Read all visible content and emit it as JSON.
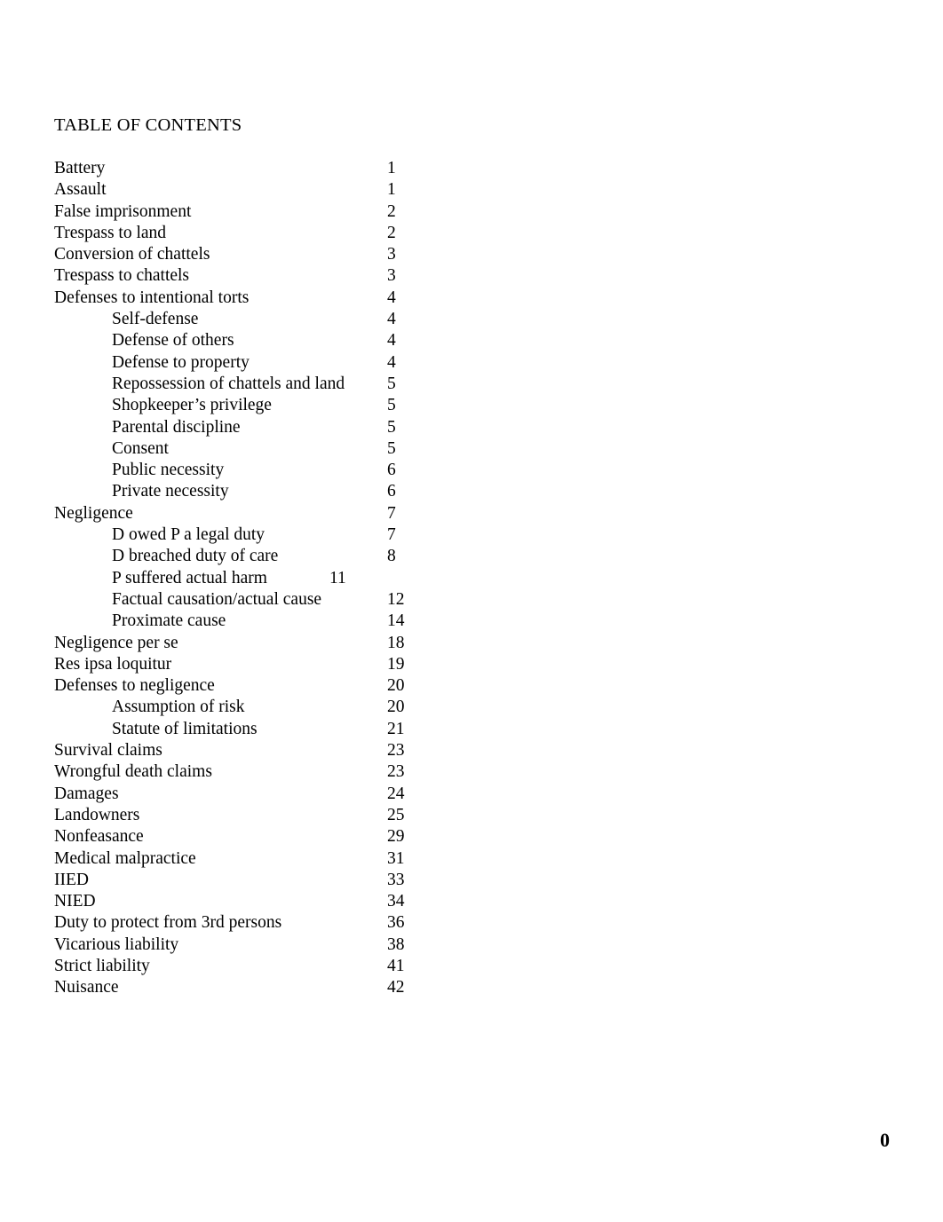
{
  "document": {
    "heading": "TABLE OF CONTENTS",
    "footer_page_number": "0"
  },
  "toc": {
    "entries": [
      {
        "label": "Battery",
        "page": "1",
        "level": 0,
        "num_style": "col-a"
      },
      {
        "label": "Assault",
        "page": "1",
        "level": 0,
        "num_style": "col-a"
      },
      {
        "label": "False imprisonment",
        "page": "2",
        "level": 0,
        "num_style": "col-a"
      },
      {
        "label": "Trespass to land",
        "page": "2",
        "level": 0,
        "num_style": "col-a"
      },
      {
        "label": "Conversion of chattels",
        "page": "3",
        "level": 0,
        "num_style": "col-a"
      },
      {
        "label": "Trespass to chattels",
        "page": "3",
        "level": 0,
        "num_style": "col-a"
      },
      {
        "label": "Defenses to intentional torts",
        "page": "4",
        "level": 0,
        "num_style": "col-a"
      },
      {
        "label": "Self-defense",
        "page": "4",
        "level": 1,
        "num_style": "col-a"
      },
      {
        "label": "Defense of others",
        "page": "4",
        "level": 1,
        "num_style": "col-a"
      },
      {
        "label": "Defense to property",
        "page": "4",
        "level": 1,
        "num_style": "col-a"
      },
      {
        "label": "Repossession of chattels and land",
        "page": "5",
        "level": 1,
        "num_style": "col-a"
      },
      {
        "label": "Shopkeeper’s privilege",
        "page": "5",
        "level": 1,
        "num_style": "col-a"
      },
      {
        "label": "Parental discipline",
        "page": "5",
        "level": 1,
        "num_style": "col-a"
      },
      {
        "label": "Consent",
        "page": "5",
        "level": 1,
        "num_style": "col-a"
      },
      {
        "label": "Public necessity",
        "page": "6",
        "level": 1,
        "num_style": "col-a"
      },
      {
        "label": "Private necessity",
        "page": "6",
        "level": 1,
        "num_style": "col-a"
      },
      {
        "label": "Negligence",
        "page": "7",
        "level": 0,
        "num_style": "col-a"
      },
      {
        "label": "D owed P a legal duty",
        "page": "7",
        "level": 1,
        "num_style": "col-a"
      },
      {
        "label": "D breached duty of care",
        "page": "8",
        "level": 1,
        "num_style": "col-a"
      },
      {
        "label": "P suffered actual harm",
        "page": "11",
        "level": 1,
        "num_style": "inline"
      },
      {
        "label": "Factual causation/actual cause",
        "page": "12",
        "level": 1,
        "num_style": "col-b"
      },
      {
        "label": "Proximate cause",
        "page": "14",
        "level": 1,
        "num_style": "col-b"
      },
      {
        "label": "Negligence per se",
        "page": "18",
        "level": 0,
        "num_style": "col-b"
      },
      {
        "label": "Res ipsa loquitur",
        "page": "19",
        "level": 0,
        "num_style": "col-b"
      },
      {
        "label": "Defenses to negligence",
        "page": "20",
        "level": 0,
        "num_style": "col-b"
      },
      {
        "label": "Assumption of risk",
        "page": "20",
        "level": 1,
        "num_style": "col-b"
      },
      {
        "label": "Statute of limitations",
        "page": "21",
        "level": 1,
        "num_style": "col-b"
      },
      {
        "label": "Survival claims",
        "page": "23",
        "level": 0,
        "num_style": "col-b"
      },
      {
        "label": "Wrongful death claims",
        "page": "23",
        "level": 0,
        "num_style": "col-b"
      },
      {
        "label": "Damages",
        "page": "24",
        "level": 0,
        "num_style": "col-b"
      },
      {
        "label": "Landowners",
        "page": "25",
        "level": 0,
        "num_style": "col-b"
      },
      {
        "label": "Nonfeasance",
        "page": "29",
        "level": 0,
        "num_style": "col-b"
      },
      {
        "label": "Medical malpractice",
        "page": "31",
        "level": 0,
        "num_style": "col-b"
      },
      {
        "label": "IIED",
        "page": "33",
        "level": 0,
        "num_style": "col-b"
      },
      {
        "label": "NIED",
        "page": "34",
        "level": 0,
        "num_style": "col-b"
      },
      {
        "label": "Duty to protect from 3rd persons",
        "page": "36",
        "level": 0,
        "num_style": "col-b"
      },
      {
        "label": "Vicarious liability",
        "page": "38",
        "level": 0,
        "num_style": "col-b"
      },
      {
        "label": "Strict liability",
        "page": "41",
        "level": 0,
        "num_style": "col-b"
      },
      {
        "label": "Nuisance",
        "page": "42",
        "level": 0,
        "num_style": "col-b"
      }
    ]
  }
}
